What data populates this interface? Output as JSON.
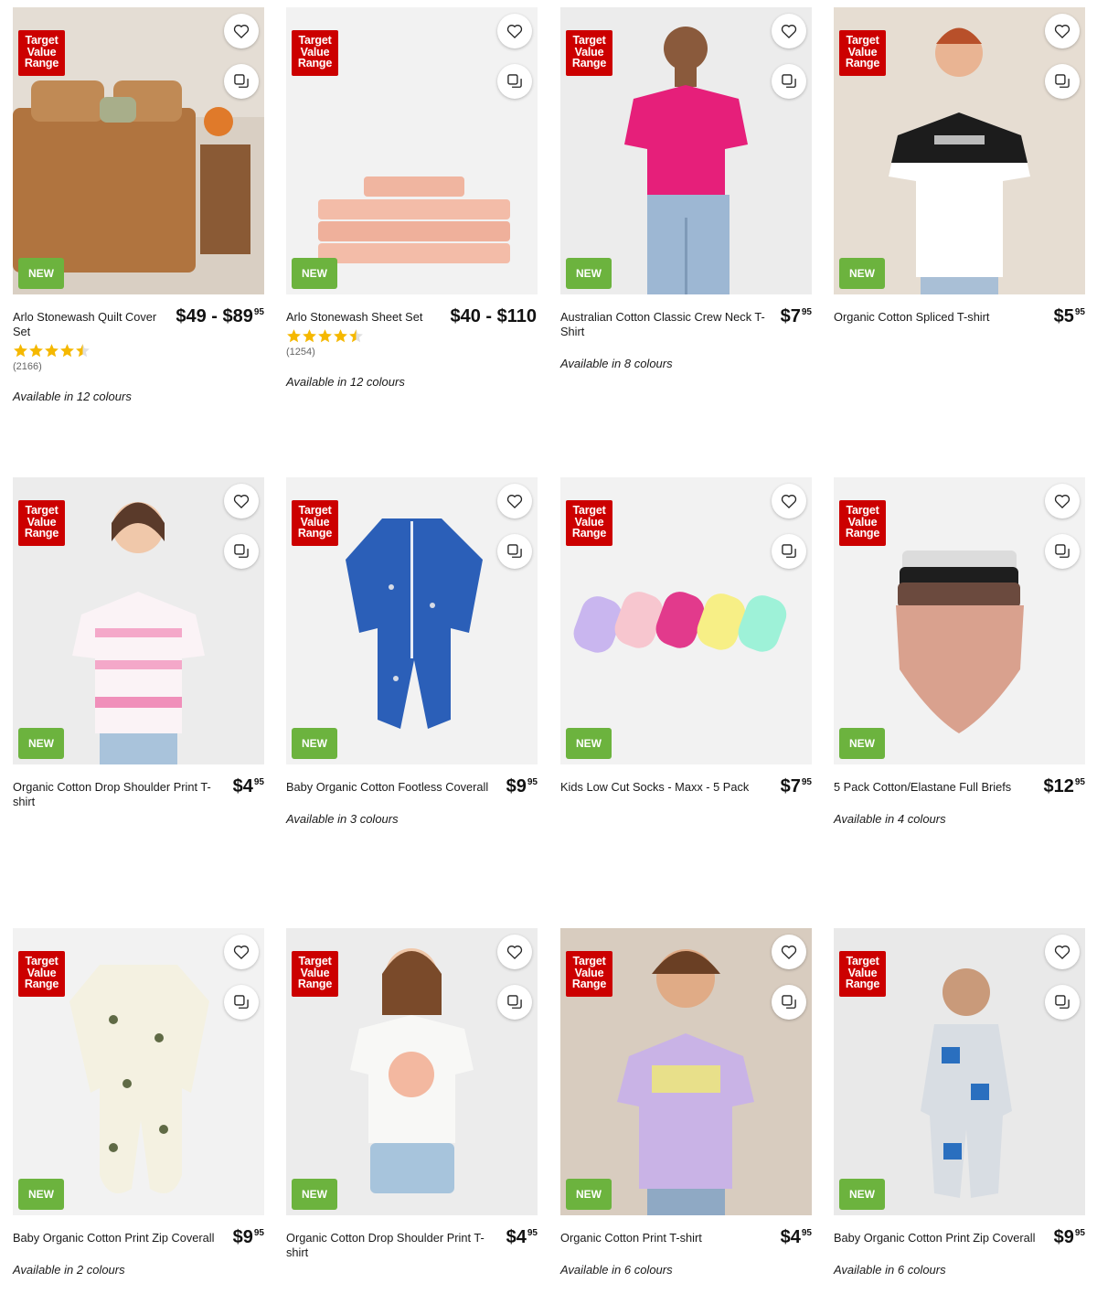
{
  "badges": {
    "tvr_line1": "Target",
    "tvr_line2": "Value",
    "tvr_line3": "Range",
    "new": "NEW"
  },
  "colors": {
    "tvr_red": "#cc0000",
    "new_green": "#6cb33e",
    "star_gold": "#f5b800"
  },
  "products": [
    {
      "title": "Arlo Stonewash Quilt Cover Set",
      "price_main": "$49 - $89",
      "price_cents": "95",
      "rating": 4.5,
      "rating_count": "(2166)",
      "availability": "Available in 12 colours"
    },
    {
      "title": "Arlo Stonewash Sheet Set",
      "price_main": "$40 - $110",
      "price_cents": "",
      "rating": 4.5,
      "rating_count": "(1254)",
      "availability": "Available in 12 colours"
    },
    {
      "title": "Australian Cotton Classic Crew Neck T-Shirt",
      "price_main": "$7",
      "price_cents": "95",
      "availability": "Available in 8 colours"
    },
    {
      "title": "Organic Cotton Spliced T-shirt",
      "price_main": "$5",
      "price_cents": "95",
      "availability": ""
    },
    {
      "title": "Organic Cotton Drop Shoulder Print T-shirt",
      "price_main": "$4",
      "price_cents": "95",
      "availability": ""
    },
    {
      "title": "Baby Organic Cotton Footless Coverall",
      "price_main": "$9",
      "price_cents": "95",
      "availability": "Available in 3 colours"
    },
    {
      "title": "Kids Low Cut Socks - Maxx - 5 Pack",
      "price_main": "$7",
      "price_cents": "95",
      "availability": ""
    },
    {
      "title": "5 Pack Cotton/Elastane Full Briefs",
      "price_main": "$12",
      "price_cents": "95",
      "availability": "Available in 4 colours"
    },
    {
      "title": "Baby Organic Cotton Print Zip Coverall",
      "price_main": "$9",
      "price_cents": "95",
      "availability": "Available in 2 colours"
    },
    {
      "title": "Organic Cotton Drop Shoulder Print T-shirt",
      "price_main": "$4",
      "price_cents": "95",
      "availability": ""
    },
    {
      "title": "Organic Cotton Print T-shirt",
      "price_main": "$4",
      "price_cents": "95",
      "availability": "Available in 6 colours"
    },
    {
      "title": "Baby Organic Cotton Print Zip Coverall",
      "price_main": "$9",
      "price_cents": "95",
      "availability": "Available in 6 colours"
    }
  ]
}
